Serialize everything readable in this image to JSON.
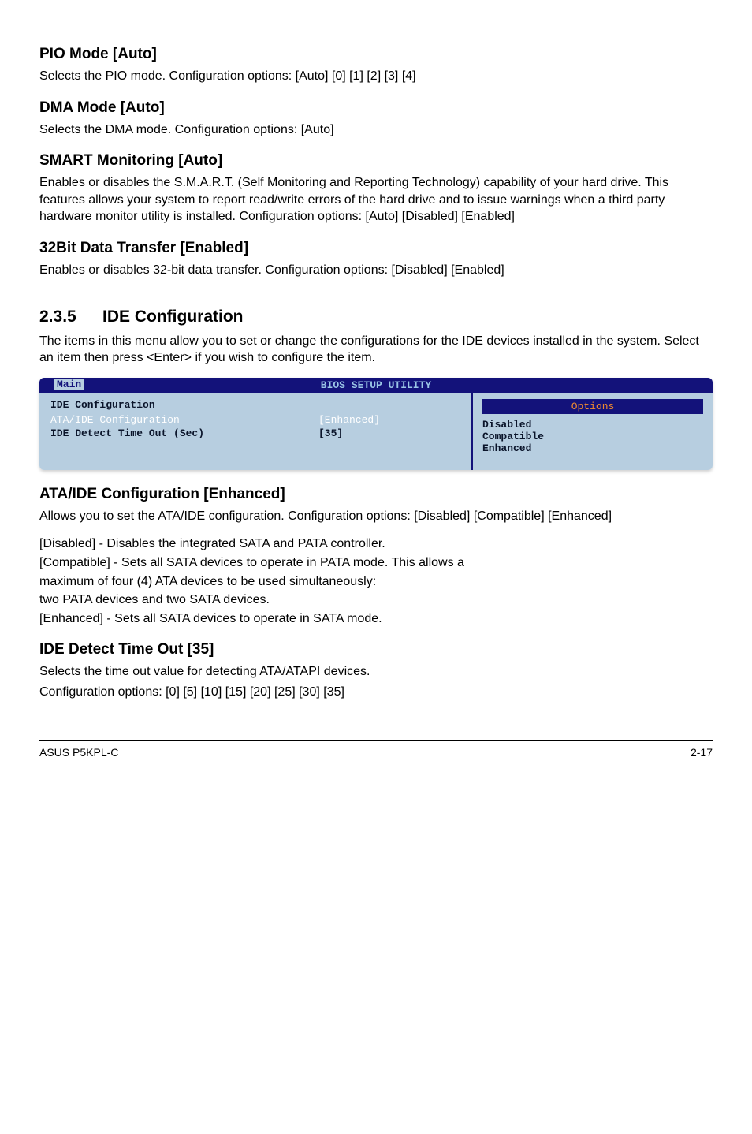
{
  "s1": {
    "title": "PIO Mode [Auto]",
    "body": "Selects the PIO mode. Configuration options: [Auto] [0] [1] [2] [3] [4]"
  },
  "s2": {
    "title": "DMA Mode [Auto]",
    "body": "Selects the DMA mode. Configuration options: [Auto]"
  },
  "s3": {
    "title": "SMART Monitoring [Auto]",
    "body": "Enables or disables the S.M.A.R.T. (Self Monitoring and Reporting Technology) capability of your hard drive. This features allows your system to report read/write errors of the hard drive and to issue warnings when a third party hardware monitor utility is installed. Configuration options: [Auto] [Disabled] [Enabled]"
  },
  "s4": {
    "title": "32Bit Data Transfer [Enabled]",
    "body": "Enables or disables 32-bit data transfer. Configuration options: [Disabled] [Enabled]"
  },
  "h235": {
    "num": "2.3.5",
    "title": "IDE Configuration",
    "intro": "The items in this menu allow you to set or change the configurations for the IDE devices installed in the system. Select an item then press <Enter> if you wish to configure the item."
  },
  "bios": {
    "utilTitle": "BIOS SETUP UTILITY",
    "tab": "Main",
    "cfgTitle": "IDE Configuration",
    "row1": {
      "label": "ATA/IDE Configuration",
      "value": "[Enhanced]"
    },
    "row2": {
      "label": "IDE Detect Time Out (Sec)",
      "value": "[35]"
    },
    "optHeader": "Options",
    "opts": [
      "Disabled",
      "Compatible",
      "Enhanced"
    ]
  },
  "s5": {
    "title": "ATA/IDE Configuration [Enhanced]",
    "body": "Allows you to set the ATA/IDE configuration. Configuration options: [Disabled] [Compatible] [Enhanced]"
  },
  "defs": {
    "d1": "[Disabled] - Disables the integrated SATA and PATA controller.",
    "d2a": "[Compatible] - Sets all SATA devices to operate in PATA mode. This allows a",
    "d2b": "maximum of four (4) ATA devices to be used simultaneously:",
    "d2c": "two PATA devices and two SATA devices.",
    "d3": "[Enhanced] - Sets all SATA devices to operate in SATA mode."
  },
  "s6": {
    "title": "IDE Detect Time Out [35]",
    "body1": "Selects the time out value for detecting ATA/ATAPI devices.",
    "body2": "Configuration options: [0] [5] [10] [15] [20] [25] [30] [35]"
  },
  "footer": {
    "left": "ASUS P5KPL-C",
    "right": "2-17"
  }
}
